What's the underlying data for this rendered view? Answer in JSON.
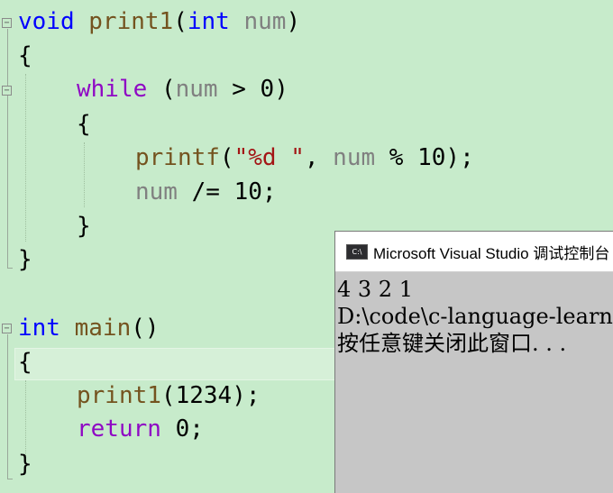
{
  "editor": {
    "lines": {
      "l1": {
        "kw": "void",
        "fn": "print1",
        "open": "(",
        "type": "int",
        "param": "num",
        "close": ")"
      },
      "l2": "{",
      "l3": {
        "kw": "while",
        "open": "(",
        "var": "num",
        "op": ">",
        "num": "0",
        "close": ")"
      },
      "l4": "{",
      "l5": {
        "fn": "printf",
        "open": "(",
        "str": "\"%d \"",
        "comma": ",",
        "var": "num",
        "op": "%",
        "num": "10",
        "close": ");"
      },
      "l6": {
        "var": "num",
        "op": "/=",
        "num": "10",
        "semi": ";"
      },
      "l7": "}",
      "l8": "}",
      "l9": {
        "kw": "int",
        "fn": "main",
        "parens": "()"
      },
      "l10": "{",
      "l11": {
        "fn": "print1",
        "open": "(",
        "num": "1234",
        "close": ");"
      },
      "l12": {
        "kw": "return",
        "num": "0",
        "semi": ";"
      },
      "l13": "}"
    }
  },
  "console": {
    "icon_label": "C:\\",
    "title": "Microsoft Visual Studio 调试控制台",
    "output": [
      "4 3 2 1",
      "D:\\code\\c-language-learning",
      "按任意键关闭此窗口. . ."
    ]
  },
  "colors": {
    "editor_bg": "#c7ebcb",
    "keyword": "#0000ff",
    "control_keyword": "#8f08c4",
    "function": "#74531f",
    "variable": "#808080",
    "string": "#a31515",
    "console_bg": "#c6c6c6"
  }
}
